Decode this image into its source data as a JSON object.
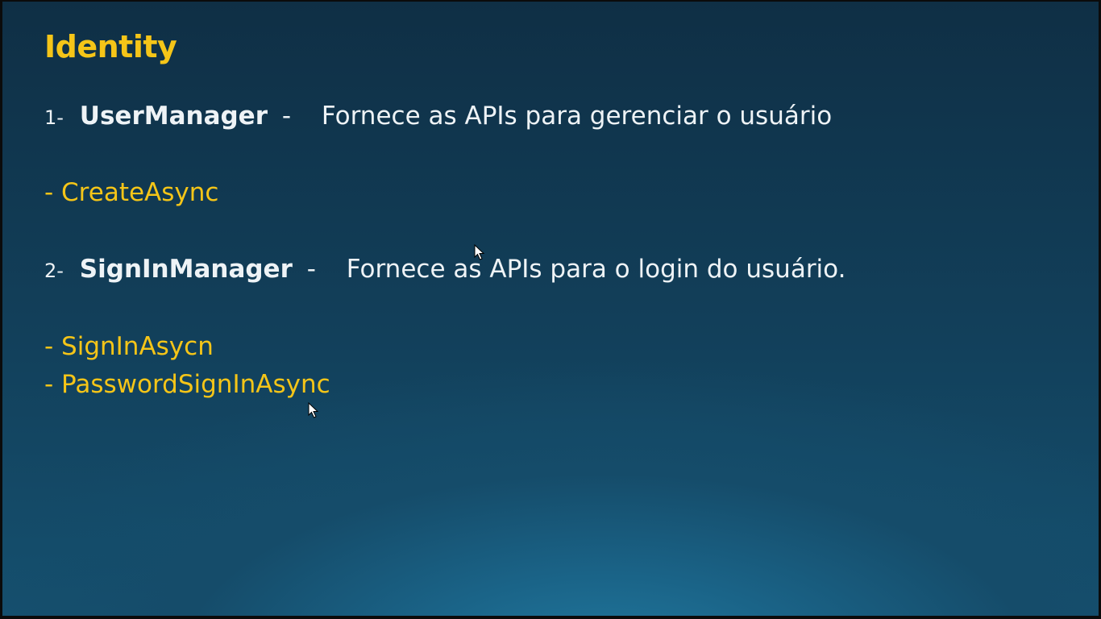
{
  "slide": {
    "title": "Identity",
    "item1": {
      "number": "1-",
      "name": "UserManager",
      "separator": "-",
      "description": "Fornece as APIs para gerenciar o usuário",
      "methods": [
        "- CreateAsync"
      ]
    },
    "item2": {
      "number": "2-",
      "name": "SignInManager",
      "separator": "-",
      "description": "Fornece as APIs para o login do usuário.",
      "methods": [
        "- SignInAsycn",
        "- PasswordSignInAsync"
      ]
    }
  },
  "colors": {
    "accent": "#f5c518",
    "text": "#eef3f6",
    "background_top": "#0f2f45",
    "background_glow": "#21799f"
  },
  "icons": [
    "mouse-pointer-icon"
  ]
}
